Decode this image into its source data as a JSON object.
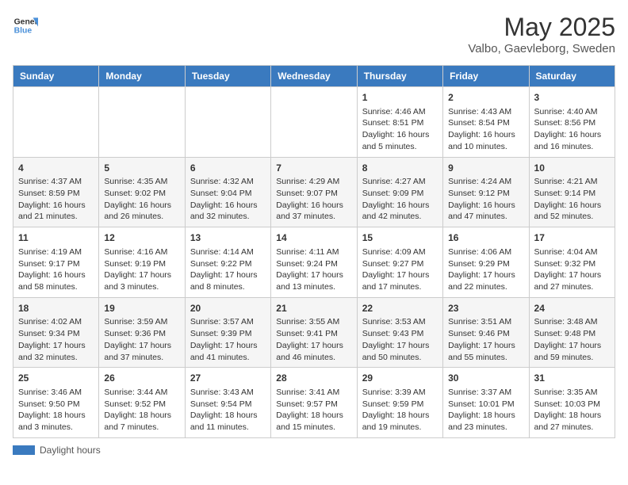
{
  "header": {
    "logo_general": "General",
    "logo_blue": "Blue",
    "month": "May 2025",
    "location": "Valbo, Gaevleborg, Sweden"
  },
  "days_of_week": [
    "Sunday",
    "Monday",
    "Tuesday",
    "Wednesday",
    "Thursday",
    "Friday",
    "Saturday"
  ],
  "weeks": [
    [
      {
        "num": "",
        "info": ""
      },
      {
        "num": "",
        "info": ""
      },
      {
        "num": "",
        "info": ""
      },
      {
        "num": "",
        "info": ""
      },
      {
        "num": "1",
        "info": "Sunrise: 4:46 AM\nSunset: 8:51 PM\nDaylight: 16 hours\nand 5 minutes."
      },
      {
        "num": "2",
        "info": "Sunrise: 4:43 AM\nSunset: 8:54 PM\nDaylight: 16 hours\nand 10 minutes."
      },
      {
        "num": "3",
        "info": "Sunrise: 4:40 AM\nSunset: 8:56 PM\nDaylight: 16 hours\nand 16 minutes."
      }
    ],
    [
      {
        "num": "4",
        "info": "Sunrise: 4:37 AM\nSunset: 8:59 PM\nDaylight: 16 hours\nand 21 minutes."
      },
      {
        "num": "5",
        "info": "Sunrise: 4:35 AM\nSunset: 9:02 PM\nDaylight: 16 hours\nand 26 minutes."
      },
      {
        "num": "6",
        "info": "Sunrise: 4:32 AM\nSunset: 9:04 PM\nDaylight: 16 hours\nand 32 minutes."
      },
      {
        "num": "7",
        "info": "Sunrise: 4:29 AM\nSunset: 9:07 PM\nDaylight: 16 hours\nand 37 minutes."
      },
      {
        "num": "8",
        "info": "Sunrise: 4:27 AM\nSunset: 9:09 PM\nDaylight: 16 hours\nand 42 minutes."
      },
      {
        "num": "9",
        "info": "Sunrise: 4:24 AM\nSunset: 9:12 PM\nDaylight: 16 hours\nand 47 minutes."
      },
      {
        "num": "10",
        "info": "Sunrise: 4:21 AM\nSunset: 9:14 PM\nDaylight: 16 hours\nand 52 minutes."
      }
    ],
    [
      {
        "num": "11",
        "info": "Sunrise: 4:19 AM\nSunset: 9:17 PM\nDaylight: 16 hours\nand 58 minutes."
      },
      {
        "num": "12",
        "info": "Sunrise: 4:16 AM\nSunset: 9:19 PM\nDaylight: 17 hours\nand 3 minutes."
      },
      {
        "num": "13",
        "info": "Sunrise: 4:14 AM\nSunset: 9:22 PM\nDaylight: 17 hours\nand 8 minutes."
      },
      {
        "num": "14",
        "info": "Sunrise: 4:11 AM\nSunset: 9:24 PM\nDaylight: 17 hours\nand 13 minutes."
      },
      {
        "num": "15",
        "info": "Sunrise: 4:09 AM\nSunset: 9:27 PM\nDaylight: 17 hours\nand 17 minutes."
      },
      {
        "num": "16",
        "info": "Sunrise: 4:06 AM\nSunset: 9:29 PM\nDaylight: 17 hours\nand 22 minutes."
      },
      {
        "num": "17",
        "info": "Sunrise: 4:04 AM\nSunset: 9:32 PM\nDaylight: 17 hours\nand 27 minutes."
      }
    ],
    [
      {
        "num": "18",
        "info": "Sunrise: 4:02 AM\nSunset: 9:34 PM\nDaylight: 17 hours\nand 32 minutes."
      },
      {
        "num": "19",
        "info": "Sunrise: 3:59 AM\nSunset: 9:36 PM\nDaylight: 17 hours\nand 37 minutes."
      },
      {
        "num": "20",
        "info": "Sunrise: 3:57 AM\nSunset: 9:39 PM\nDaylight: 17 hours\nand 41 minutes."
      },
      {
        "num": "21",
        "info": "Sunrise: 3:55 AM\nSunset: 9:41 PM\nDaylight: 17 hours\nand 46 minutes."
      },
      {
        "num": "22",
        "info": "Sunrise: 3:53 AM\nSunset: 9:43 PM\nDaylight: 17 hours\nand 50 minutes."
      },
      {
        "num": "23",
        "info": "Sunrise: 3:51 AM\nSunset: 9:46 PM\nDaylight: 17 hours\nand 55 minutes."
      },
      {
        "num": "24",
        "info": "Sunrise: 3:48 AM\nSunset: 9:48 PM\nDaylight: 17 hours\nand 59 minutes."
      }
    ],
    [
      {
        "num": "25",
        "info": "Sunrise: 3:46 AM\nSunset: 9:50 PM\nDaylight: 18 hours\nand 3 minutes."
      },
      {
        "num": "26",
        "info": "Sunrise: 3:44 AM\nSunset: 9:52 PM\nDaylight: 18 hours\nand 7 minutes."
      },
      {
        "num": "27",
        "info": "Sunrise: 3:43 AM\nSunset: 9:54 PM\nDaylight: 18 hours\nand 11 minutes."
      },
      {
        "num": "28",
        "info": "Sunrise: 3:41 AM\nSunset: 9:57 PM\nDaylight: 18 hours\nand 15 minutes."
      },
      {
        "num": "29",
        "info": "Sunrise: 3:39 AM\nSunset: 9:59 PM\nDaylight: 18 hours\nand 19 minutes."
      },
      {
        "num": "30",
        "info": "Sunrise: 3:37 AM\nSunset: 10:01 PM\nDaylight: 18 hours\nand 23 minutes."
      },
      {
        "num": "31",
        "info": "Sunrise: 3:35 AM\nSunset: 10:03 PM\nDaylight: 18 hours\nand 27 minutes."
      }
    ]
  ],
  "legend": {
    "label": "Daylight hours"
  }
}
